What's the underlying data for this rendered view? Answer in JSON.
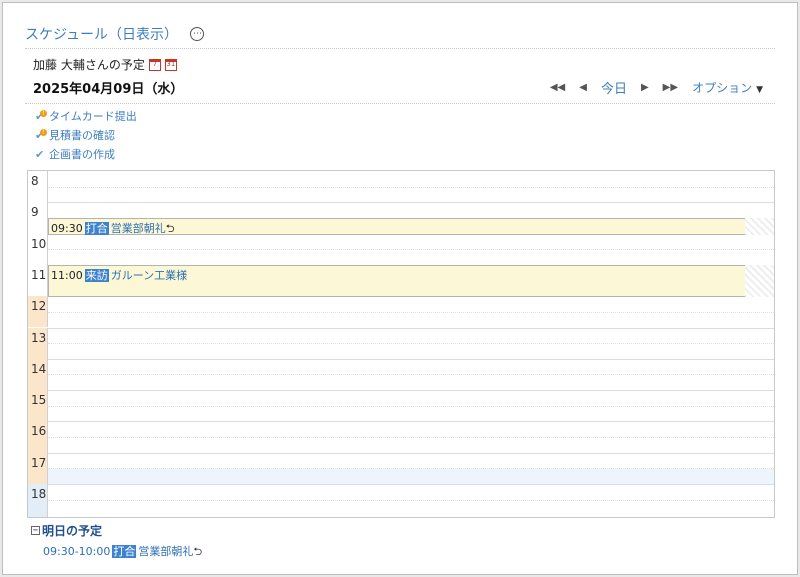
{
  "header": {
    "title": "スケジュール（日表示）",
    "more_icon": "⋯"
  },
  "owner": {
    "name": "加藤 大輔さんの予定",
    "cal_week_text": "7",
    "cal_month_text": "31"
  },
  "date": "2025年04月09日（水）",
  "nav": {
    "first": "◀◀",
    "prev": "◀",
    "today": "今日",
    "next": "▶",
    "last": "▶▶",
    "options": "オプション",
    "caret": "▼"
  },
  "todos": [
    {
      "label": "タイムカード提出",
      "done": false
    },
    {
      "label": "見積書の確認",
      "done": false
    },
    {
      "label": "企画書の作成",
      "done": true
    }
  ],
  "hours": [
    "8",
    "9",
    "10",
    "11",
    "12",
    "13",
    "14",
    "15",
    "16",
    "17",
    "18"
  ],
  "events": [
    {
      "time": "09:30",
      "tag": "打合",
      "name": "営業部朝礼",
      "repeat": "⮌"
    },
    {
      "time": "11:00",
      "tag": "来訪",
      "name": "ガルーン工業様",
      "repeat": ""
    }
  ],
  "tomorrow": {
    "toggle": "−",
    "heading": "明日の予定",
    "events": [
      {
        "time": "09:30-10:00",
        "tag": "打合",
        "name": "営業部朝礼",
        "repeat": "⮌"
      }
    ]
  }
}
